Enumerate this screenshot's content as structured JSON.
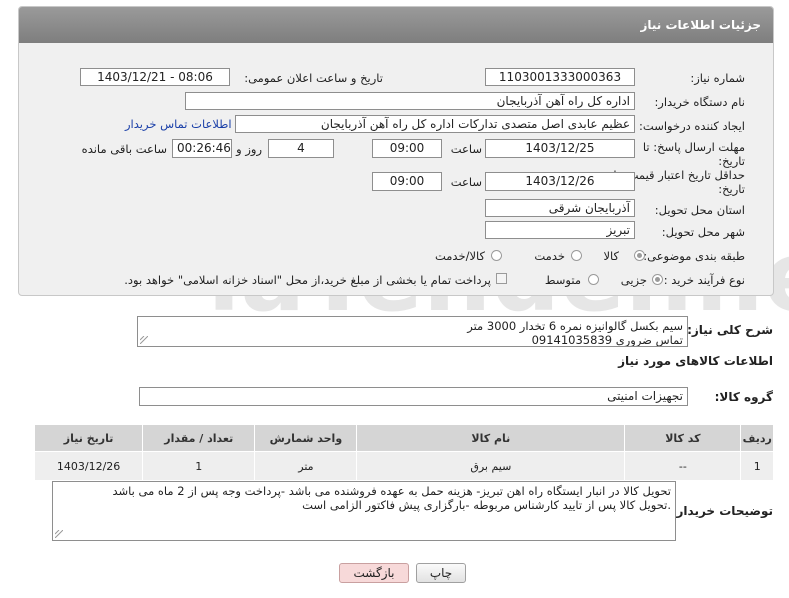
{
  "header": {
    "title": "جزئیات اطلاعات نیاز"
  },
  "form": {
    "need_number_label": "شماره نیاز:",
    "need_number": "1103001333000363",
    "announce_label": "تاریخ و ساعت اعلان عمومی:",
    "announce_value": "1403/12/21 - 08:06",
    "buyer_org_label": "نام دستگاه خریدار:",
    "buyer_org": "اداره کل راه آهن آذربایجان",
    "creator_label": "ایجاد کننده درخواست:",
    "creator": "عظیم عابدی اصل متصدی تدارکات اداره کل راه آهن آذربایجان",
    "contact_link": "اطلاعات تماس خریدار",
    "deadline_label_1": "مهلت ارسال پاسخ: تا",
    "deadline_label_2": "تاریخ:",
    "deadline_date": "1403/12/25",
    "time_label": "ساعت",
    "deadline_time": "09:00",
    "days": "4",
    "days_label": "روز و",
    "remaining": "00:26:46",
    "remaining_label": "ساعت باقی مانده",
    "validity_label_1": "حداقل تاریخ اعتبار قیمت: تا",
    "validity_label_2": "تاریخ:",
    "validity_date": "1403/12/26",
    "validity_time": "09:00",
    "province_label": "استان محل تحویل:",
    "province": "آذربایجان شرقی",
    "city_label": "شهر محل تحویل:",
    "city": "تبریز",
    "category_label": "طبقه بندی موضوعی:",
    "category_options": [
      "کالا",
      "خدمت",
      "کالا/خدمت"
    ],
    "process_label": "نوع فرآیند خرید :",
    "process_options": [
      "جزیی",
      "متوسط"
    ],
    "payment_note": "پرداخت تمام یا بخشی از مبلغ خرید،از محل \"اسناد خزانه اسلامی\" خواهد بود."
  },
  "description": {
    "label": "شرح کلی نیاز:",
    "lines": [
      "سیم بکسل گالوانیزه نمره 6  تخدار 3000 متر",
      "تماس ضروری 09141035839"
    ]
  },
  "goods_info": {
    "title": "اطلاعات کالاهای مورد نیاز",
    "group_label": "گروه کالا:",
    "group_value": "تجهیزات امنیتی"
  },
  "table": {
    "headers": [
      "ردیف",
      "کد کالا",
      "نام کالا",
      "واحد شمارش",
      "تعداد / مقدار",
      "تاریخ نیاز"
    ],
    "rows": [
      [
        "1",
        "--",
        "سیم برق",
        "متر",
        "1",
        "1403/12/26"
      ]
    ]
  },
  "buyer_notes": {
    "label": "توضیحات خریدار:",
    "lines": [
      "تحویل کالا در انبار ایستگاه راه اهن تبریز- هزینه حمل به عهده  فروشنده می باشد -پرداخت وجه پس از 2 ماه می باشد",
      ".تحویل کالا پس از  تایید کارشناس مربوطه -بارگزاری پیش فاکتور الزامی است"
    ]
  },
  "buttons": {
    "print": "چاپ",
    "back": "بازگشت"
  },
  "colors": {
    "header_bg": "#8a8a8a",
    "panel_bg": "#f0f0f0",
    "link": "#1a3fa8",
    "back_button_bg": "#f7d9d9"
  }
}
